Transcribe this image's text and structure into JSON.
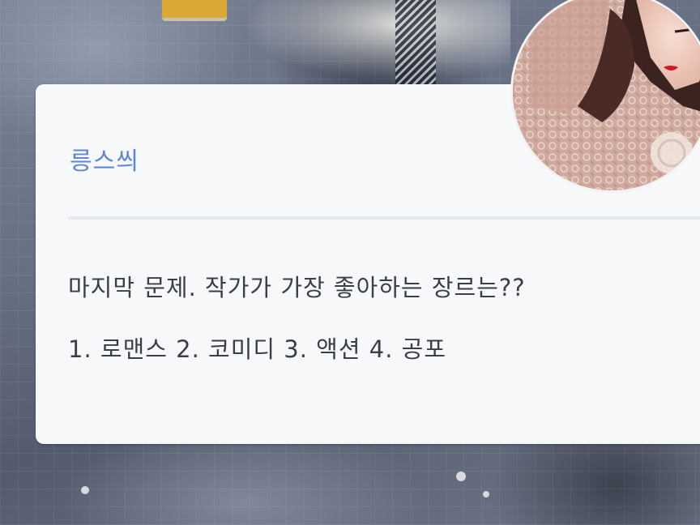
{
  "speaker": {
    "name": "릉스씌",
    "name_color": "#5f86d6"
  },
  "message": {
    "line1": "마지막 문제. 작가가 가장 좋아하는 장르는??",
    "line2": "1. 로맨스 2. 코미디 3. 액션 4. 공포"
  },
  "avatar": {
    "icon": "portrait-avatar"
  },
  "colors": {
    "card_background": "#f7f8fa",
    "text": "#3a3f47",
    "divider": "#e6e9ee"
  }
}
